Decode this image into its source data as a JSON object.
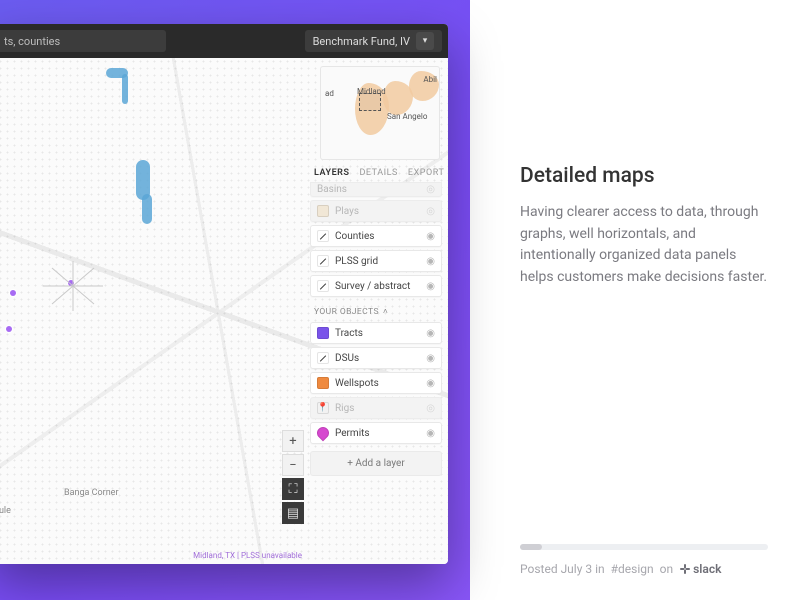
{
  "topbar": {
    "search_placeholder": "ts, counties",
    "fund_selected": "Benchmark Fund, IV"
  },
  "minimap": {
    "labels": {
      "left": "ad",
      "center": "Midland",
      "right_top": "Abil",
      "right_bottom": "San Angelo"
    }
  },
  "map": {
    "place_labels": {
      "banga_corner": "Banga Corner",
      "tule": "Tule"
    },
    "footer": "Midland, TX  |  PLSS unavailable"
  },
  "panel": {
    "tabs": {
      "layers": "LAYERS",
      "details": "DETAILS",
      "export": "EXPORT"
    },
    "sections": {
      "basins": "Basins",
      "your_objects": "YOUR OBJECTS"
    },
    "layers_main": [
      {
        "label": "Plays"
      },
      {
        "label": "Counties"
      },
      {
        "label": "PLSS grid"
      },
      {
        "label": "Survey / abstract"
      }
    ],
    "layers_objects": [
      {
        "label": "Tracts"
      },
      {
        "label": "DSUs"
      },
      {
        "label": "Wellspots"
      },
      {
        "label": "Rigs"
      },
      {
        "label": "Permits"
      }
    ],
    "add_layer": "+  Add a layer"
  },
  "article": {
    "title": "Detailed maps",
    "body": "Having clearer access to data, through graphs, well horizontals, and intentionally organized data panels helps customers make decisions faster."
  },
  "footer": {
    "posted_prefix": "Posted July 3 in ",
    "channel": "#design",
    "on": " on ",
    "brand": "slack"
  }
}
